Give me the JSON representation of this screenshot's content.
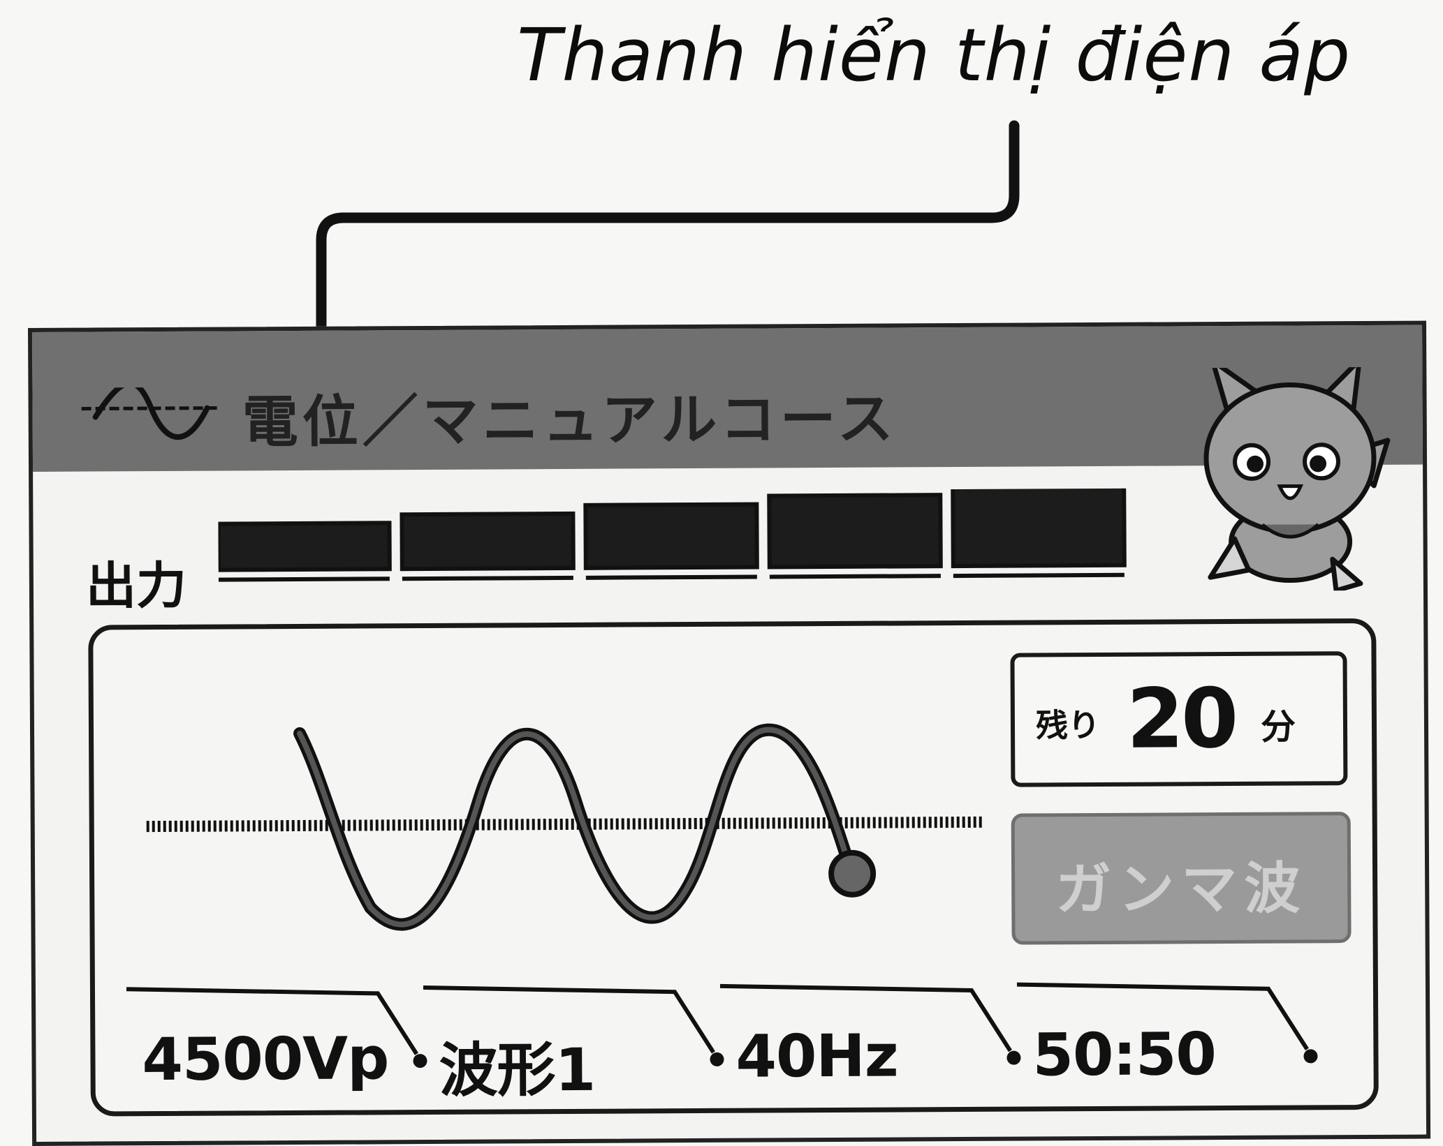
{
  "annotation": {
    "label": "Thanh hiển thị điện áp"
  },
  "header": {
    "title": "電位／マニュアルコース",
    "icon": "sine-wave-icon",
    "mascot": "cat-mascot-icon"
  },
  "output": {
    "label": "出力",
    "segments_total": 5,
    "segments_lit": 5
  },
  "timer": {
    "label": "残り",
    "value": "20",
    "unit": "分"
  },
  "mode": {
    "label": "ガンマ波",
    "state": "inactive"
  },
  "params": [
    {
      "value": "4500Vp"
    },
    {
      "value": "波形1"
    },
    {
      "value": "40Hz"
    },
    {
      "value": "50:50"
    }
  ],
  "colors": {
    "header_bg": "#707070",
    "segment_fill": "#1c1c1c",
    "mode_bg": "#9a9a9a",
    "mode_text": "#cfcfcf"
  }
}
